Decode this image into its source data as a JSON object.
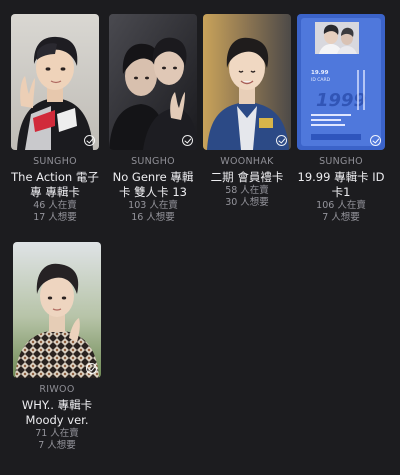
{
  "cards": [
    {
      "member": "SUNGHO",
      "title": "The Action 電子專 專輯卡",
      "selling": "46 人在賣",
      "wanting": "17 人想要",
      "selected": true
    },
    {
      "member": "SUNGHO",
      "title": "No Genre 專輯卡 雙人卡 13",
      "selling": "103 人在賣",
      "wanting": "16 人想要",
      "selected": true
    },
    {
      "member": "WOONHAK",
      "title": "二期 會員禮卡",
      "selling": "58 人在賣",
      "wanting": "30 人想要",
      "selected": true
    },
    {
      "member": "SUNGHO",
      "title": "19.99 專輯卡 ID卡1",
      "selling": "106 人在賣",
      "wanting": "7 人想要",
      "selected": true
    },
    {
      "member": "RIWOO",
      "title": "WHY.. 專輯卡 Moody ver.",
      "selling": "71 人在賣",
      "wanting": "7 人想要",
      "selected": true
    }
  ],
  "id_card_text": [
    "19.99",
    "ID CARD",
    "1999"
  ],
  "colors": {
    "background": "#1c1c1f",
    "member": "#8f8f96",
    "title": "#ededf0",
    "stat": "#95959c",
    "id_card_blue": "#3b63c9"
  },
  "icons": {
    "select": "check-circle-icon"
  }
}
